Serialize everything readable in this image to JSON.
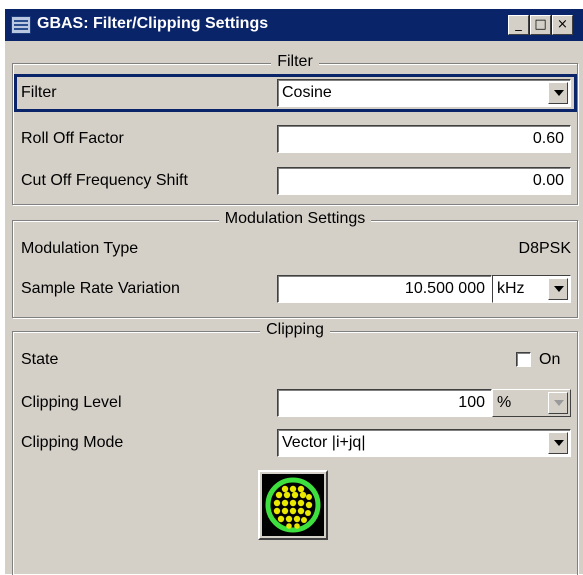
{
  "window": {
    "title": "GBAS: Filter/Clipping Settings"
  },
  "titlebar_buttons": {
    "minimize": "_",
    "restore": "□",
    "close": "×"
  },
  "filter_group": {
    "title": "Filter",
    "filter": {
      "label": "Filter",
      "value": "Cosine"
    },
    "roll_off": {
      "label": "Roll Off Factor",
      "value": "0.60"
    },
    "cut_off": {
      "label": "Cut Off Frequency Shift",
      "value": "0.00"
    }
  },
  "modulation_group": {
    "title": "Modulation Settings",
    "type": {
      "label": "Modulation Type",
      "value": "D8PSK"
    },
    "sample_rate": {
      "label": "Sample Rate Variation",
      "value": "10.500 000",
      "unit": "kHz"
    }
  },
  "clipping_group": {
    "title": "Clipping",
    "state": {
      "label": "State",
      "checkbox_label": "On",
      "checked": false
    },
    "level": {
      "label": "Clipping Level",
      "value": "100",
      "unit": "%"
    },
    "mode": {
      "label": "Clipping Mode",
      "value": "Vector |i+jq|"
    }
  },
  "icons": {
    "constellation": "constellation-icon",
    "app": "app-icon"
  }
}
